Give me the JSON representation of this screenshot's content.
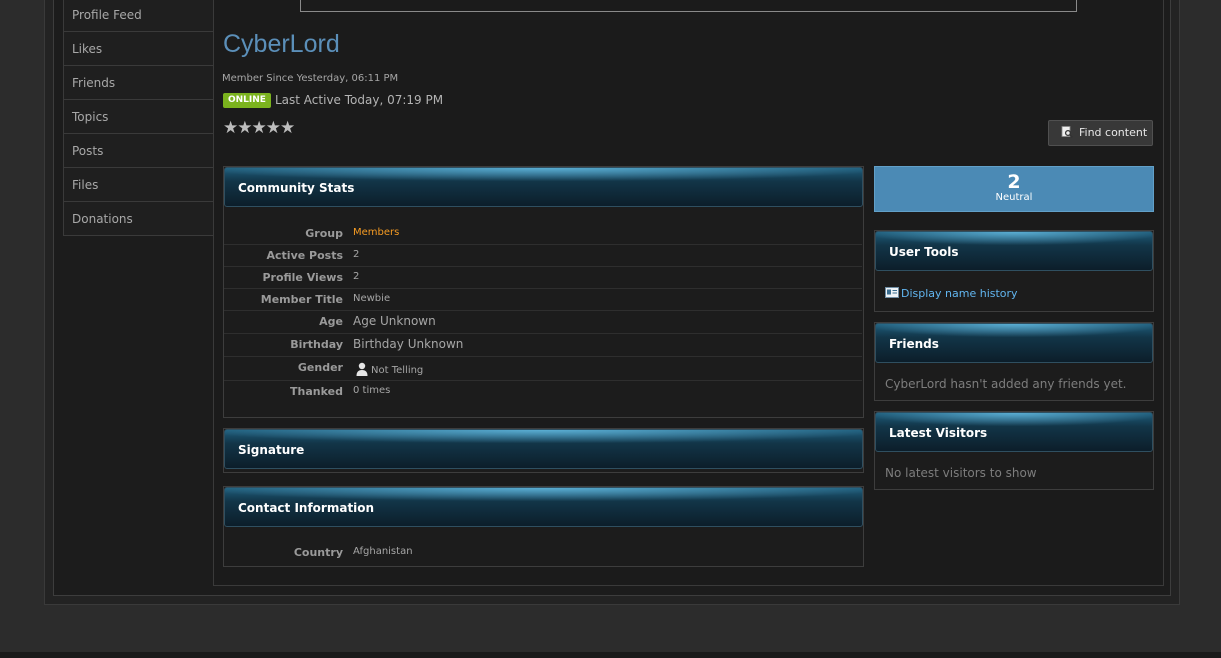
{
  "sidebar": {
    "items": [
      {
        "label": "Profile Feed"
      },
      {
        "label": "Likes"
      },
      {
        "label": "Friends"
      },
      {
        "label": "Topics"
      },
      {
        "label": "Posts"
      },
      {
        "label": "Files"
      },
      {
        "label": "Donations"
      }
    ]
  },
  "profile": {
    "username": "CyberLord",
    "member_since": "Member Since Yesterday, 06:11 PM",
    "online_badge": "ONLINE",
    "last_active": "Last Active Today, 07:19 PM",
    "rating_stars": "★★★★★",
    "rating_value": 0,
    "rating_max": 5,
    "find_content_label": "Find content",
    "find_content_icon": "magnifier-icon"
  },
  "community_stats": {
    "title": "Community Stats",
    "rows": [
      {
        "label": "Group",
        "value": "Members"
      },
      {
        "label": "Active Posts",
        "value": "2"
      },
      {
        "label": "Profile Views",
        "value": "2"
      },
      {
        "label": "Member Title",
        "value": "Newbie"
      },
      {
        "label": "Age",
        "value": "Age Unknown"
      },
      {
        "label": "Birthday",
        "value": "Birthday Unknown"
      },
      {
        "label": "Gender",
        "value": "Not Telling"
      },
      {
        "label": "Thanked",
        "value": "0 times"
      }
    ]
  },
  "signature": {
    "title": "Signature"
  },
  "contact": {
    "title": "Contact Information",
    "rows": [
      {
        "label": "Country",
        "value": "Afghanistan"
      }
    ]
  },
  "reputation": {
    "value": "2",
    "label": "Neutral"
  },
  "user_tools": {
    "title": "User Tools",
    "link": "Display name history"
  },
  "friends": {
    "title": "Friends",
    "empty_text": "CyberLord hasn't added any friends yet."
  },
  "latest_visitors": {
    "title": "Latest Visitors",
    "empty_text": "No latest visitors to show"
  },
  "colors": {
    "username": "#5b8fb9",
    "online_badge": "#7bb31e",
    "group_value": "#f59b23",
    "reputation_bg": "#4b8ab5",
    "link": "#62b6f0"
  }
}
